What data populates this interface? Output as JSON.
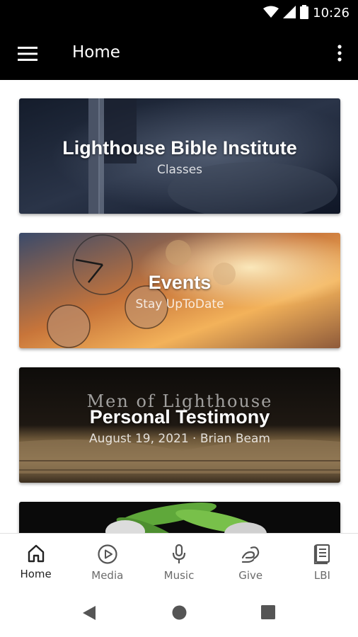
{
  "status_bar": {
    "time": "10:26"
  },
  "app_bar": {
    "title": "Home"
  },
  "cards": [
    {
      "title": "Lighthouse Bible Institute",
      "subtitle": "Classes"
    },
    {
      "title": "Events",
      "subtitle": "Stay UpToDate"
    },
    {
      "overlay_text": "Men of Lighthouse",
      "title": "Personal Testimony",
      "subtitle": "August 19, 2021 · Brian Beam"
    }
  ],
  "bottom_nav": {
    "items": [
      {
        "label": "Home",
        "icon": "home-icon",
        "active": true
      },
      {
        "label": "Media",
        "icon": "play-circle-icon",
        "active": false
      },
      {
        "label": "Music",
        "icon": "microphone-icon",
        "active": false
      },
      {
        "label": "Give",
        "icon": "give-icon",
        "active": false
      },
      {
        "label": "LBI",
        "icon": "book-icon",
        "active": false
      }
    ]
  },
  "colors": {
    "bar": "#000000",
    "active_nav": "#222222",
    "inactive_nav": "#6b6b6b"
  }
}
